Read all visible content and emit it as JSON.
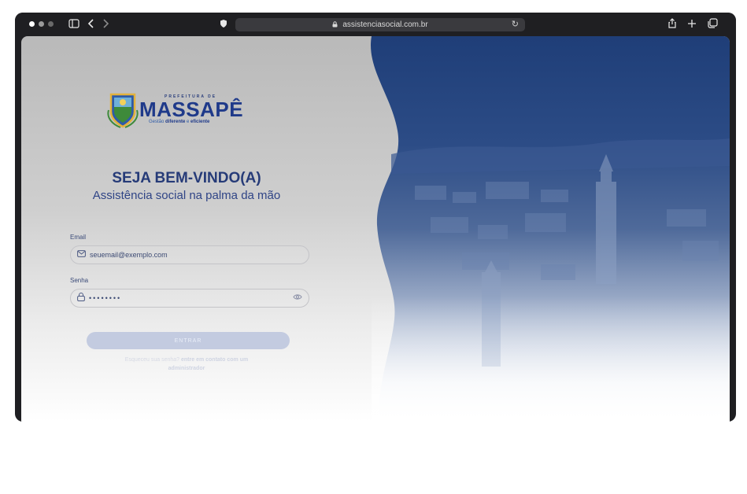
{
  "browser": {
    "url": "assistenciasocial.com.br",
    "icons": {
      "sidebar": "sidebar-icon",
      "back": "back-icon",
      "forward": "forward-icon",
      "shield": "shield-icon",
      "lock": "lock-icon",
      "reload": "reload-icon",
      "share": "share-icon",
      "new_tab": "plus-icon",
      "tabs": "tabs-icon"
    },
    "traffic_lights": [
      "#ffffff",
      "#9a9a9a",
      "#6a6a6a"
    ]
  },
  "logo": {
    "top_text": "PREFEITURA DE",
    "name": "MASSAPÊ",
    "tagline_prefix": "Gestão ",
    "tagline_bold": "diferente",
    "tagline_mid": " e ",
    "tagline_end": "eficiente"
  },
  "login": {
    "title": "SEJA BEM-VINDO(A)",
    "subtitle": "Assistência social na palma da mão",
    "email_label": "Email",
    "email_placeholder": "seuemail@exemplo.com",
    "password_label": "Senha",
    "password_value": "••••••••",
    "submit_label": "ENTRAR",
    "forgot_prefix": "Esqueceu sua senha? ",
    "forgot_link": "entre em contato com um administrador"
  },
  "colors": {
    "brand_blue": "#1f3a8a",
    "hero_blue": "#2a4a86",
    "button": "#c3cbe0"
  }
}
